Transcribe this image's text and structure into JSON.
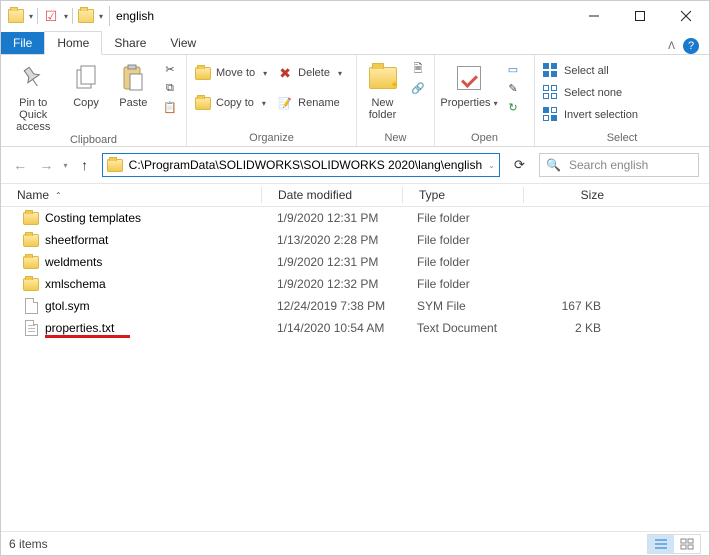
{
  "title": "english",
  "tabs": {
    "file": "File",
    "home": "Home",
    "share": "Share",
    "view": "View"
  },
  "ribbon": {
    "clipboard": {
      "label": "Clipboard",
      "pin": "Pin to Quick access",
      "copy": "Copy",
      "paste": "Paste"
    },
    "organize": {
      "label": "Organize",
      "move_to": "Move to",
      "copy_to": "Copy to",
      "delete": "Delete",
      "rename": "Rename"
    },
    "new": {
      "label": "New",
      "new_folder": "New folder"
    },
    "open": {
      "label": "Open",
      "properties": "Properties"
    },
    "select": {
      "label": "Select",
      "select_all": "Select all",
      "select_none": "Select none",
      "invert": "Invert selection"
    }
  },
  "address": {
    "path": "C:\\ProgramData\\SOLIDWORKS\\SOLIDWORKS 2020\\lang\\english"
  },
  "search": {
    "placeholder": "Search english"
  },
  "columns": {
    "name": "Name",
    "date": "Date modified",
    "type": "Type",
    "size": "Size"
  },
  "items": [
    {
      "icon": "folder",
      "name": "Costing templates",
      "date": "1/9/2020 12:31 PM",
      "type": "File folder",
      "size": "",
      "highlight": false
    },
    {
      "icon": "folder",
      "name": "sheetformat",
      "date": "1/13/2020 2:28 PM",
      "type": "File folder",
      "size": "",
      "highlight": false
    },
    {
      "icon": "folder",
      "name": "weldments",
      "date": "1/9/2020 12:31 PM",
      "type": "File folder",
      "size": "",
      "highlight": false
    },
    {
      "icon": "folder",
      "name": "xmlschema",
      "date": "1/9/2020 12:32 PM",
      "type": "File folder",
      "size": "",
      "highlight": false
    },
    {
      "icon": "file",
      "name": "gtol.sym",
      "date": "12/24/2019 7:38 PM",
      "type": "SYM File",
      "size": "167 KB",
      "highlight": false
    },
    {
      "icon": "text",
      "name": "properties.txt",
      "date": "1/14/2020 10:54 AM",
      "type": "Text Document",
      "size": "2 KB",
      "highlight": true
    }
  ],
  "status": {
    "count": "6 items"
  }
}
